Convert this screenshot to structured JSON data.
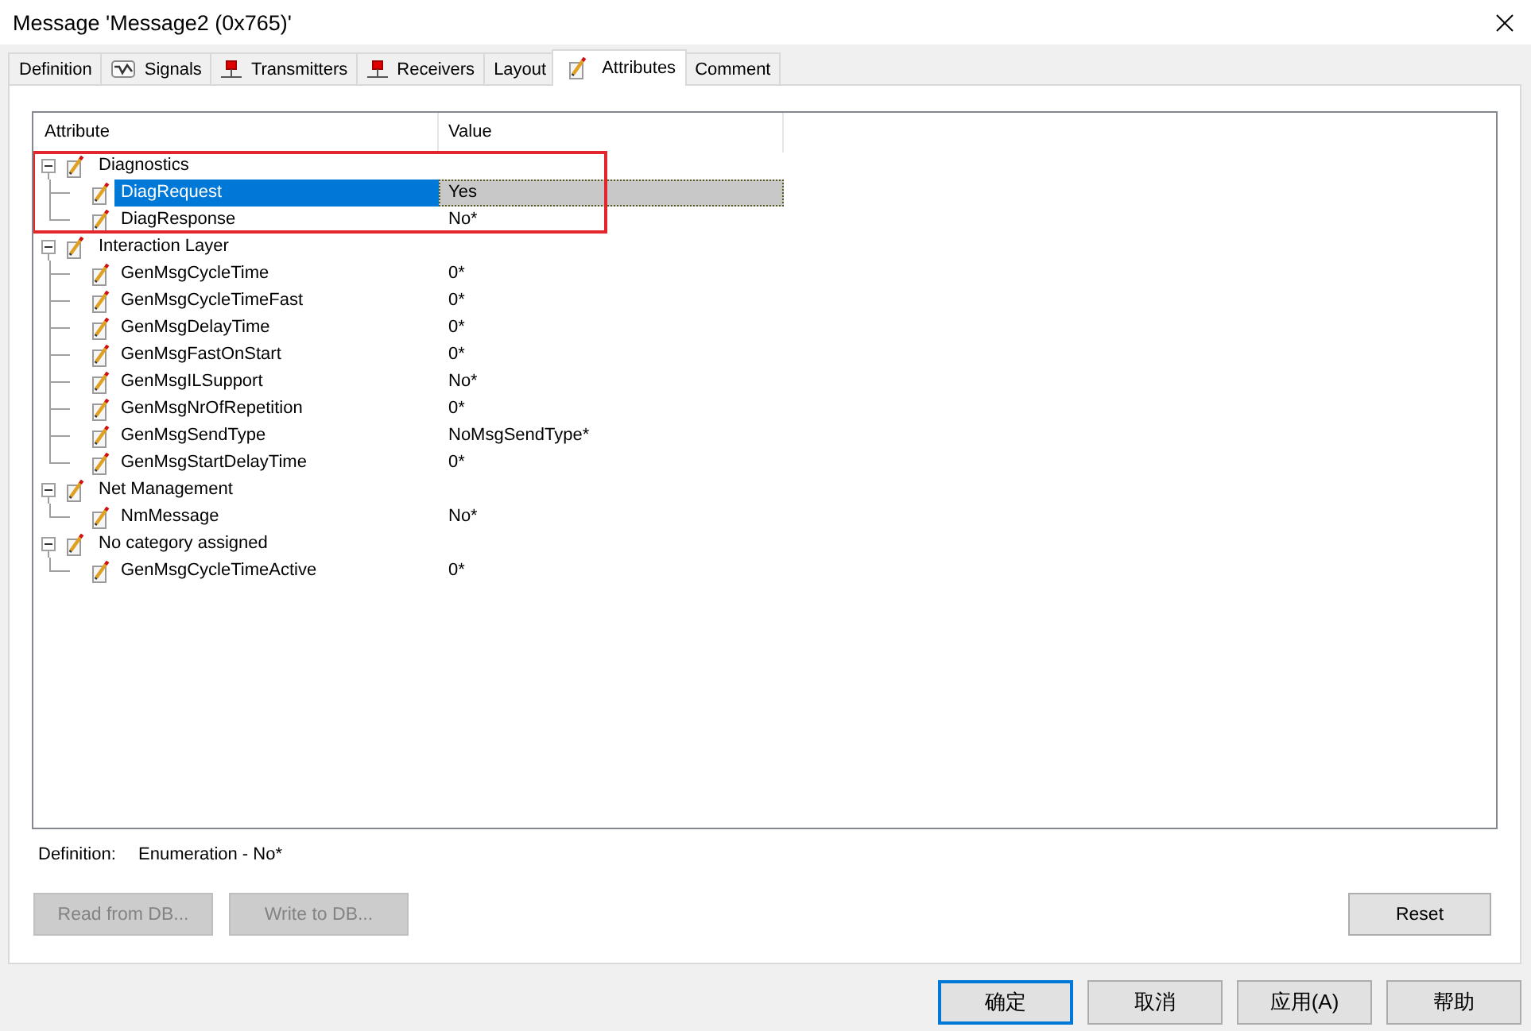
{
  "window": {
    "title": "Message 'Message2 (0x765)'"
  },
  "tabs": [
    {
      "label": "Definition",
      "kind": "plain",
      "selected": false
    },
    {
      "label": "Signals",
      "kind": "signals",
      "selected": false
    },
    {
      "label": "Transmitters",
      "kind": "node",
      "selected": false
    },
    {
      "label": "Receivers",
      "kind": "node",
      "selected": false
    },
    {
      "label": "Layout",
      "kind": "plain",
      "selected": false
    },
    {
      "label": "Attributes",
      "kind": "attributes",
      "selected": true
    },
    {
      "label": "Comment",
      "kind": "plain",
      "selected": false
    }
  ],
  "attribute_list": {
    "columns": [
      "Attribute",
      "Value"
    ],
    "groups": [
      {
        "name": "Diagnostics",
        "expanded": true,
        "selected": false,
        "highlighted": true,
        "children": [
          {
            "name": "DiagRequest",
            "value": "Yes",
            "selected": true
          },
          {
            "name": "DiagResponse",
            "value": "No*",
            "selected": false
          }
        ]
      },
      {
        "name": "Interaction Layer",
        "expanded": true,
        "selected": false,
        "highlighted": false,
        "children": [
          {
            "name": "GenMsgCycleTime",
            "value": "0*",
            "selected": false
          },
          {
            "name": "GenMsgCycleTimeFast",
            "value": "0*",
            "selected": false
          },
          {
            "name": "GenMsgDelayTime",
            "value": "0*",
            "selected": false
          },
          {
            "name": "GenMsgFastOnStart",
            "value": "0*",
            "selected": false
          },
          {
            "name": "GenMsgILSupport",
            "value": "No*",
            "selected": false
          },
          {
            "name": "GenMsgNrOfRepetition",
            "value": "0*",
            "selected": false
          },
          {
            "name": "GenMsgSendType",
            "value": "NoMsgSendType*",
            "selected": false
          },
          {
            "name": "GenMsgStartDelayTime",
            "value": "0*",
            "selected": false
          }
        ]
      },
      {
        "name": "Net Management",
        "expanded": true,
        "selected": false,
        "highlighted": false,
        "children": [
          {
            "name": "NmMessage",
            "value": "No*",
            "selected": false
          }
        ]
      },
      {
        "name": "No category assigned",
        "expanded": true,
        "selected": false,
        "highlighted": false,
        "children": [
          {
            "name": "GenMsgCycleTimeActive",
            "value": "0*",
            "selected": false
          }
        ]
      }
    ]
  },
  "definition": {
    "label": "Definition:",
    "value": "Enumeration - No*"
  },
  "db_buttons": [
    {
      "label": "Read from DB...",
      "disabled": true
    },
    {
      "label": "Write to DB...",
      "disabled": true
    }
  ],
  "reset_button": {
    "label": "Reset",
    "disabled": false
  },
  "dialog_buttons": [
    {
      "label": "确定",
      "default": true
    },
    {
      "label": "取消",
      "default": false
    },
    {
      "label": "应用(A)",
      "default": false
    },
    {
      "label": "帮助",
      "default": false
    }
  ]
}
